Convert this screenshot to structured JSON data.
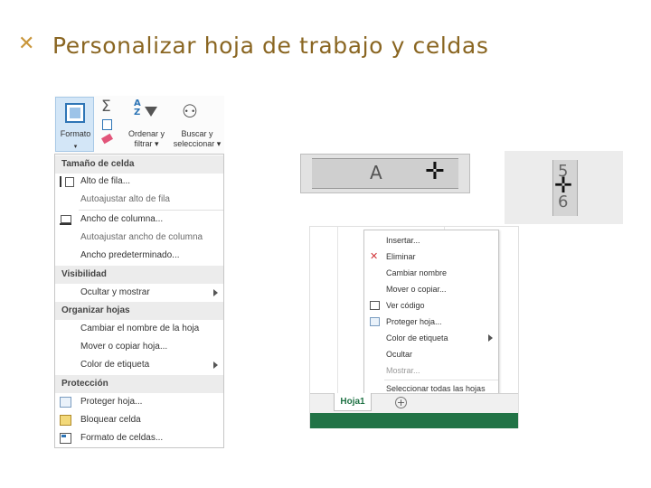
{
  "slide": {
    "bullet_glyph": "✕",
    "title": "Personalizar hoja de trabajo y celdas"
  },
  "ribbon": {
    "format_button": "Formato",
    "format_caret": "▾",
    "sort_filter": "Ordenar y filtrar ▾",
    "find_select": "Buscar y seleccionar ▾",
    "sort_icon_text": "A\nZ"
  },
  "format_menu": {
    "cell_size_header": "Tamaño de celda",
    "row_height": "Alto de fila...",
    "autofit_row_height": "Autoajustar alto de fila",
    "column_width": "Ancho de columna...",
    "autofit_column_width": "Autoajustar ancho de columna",
    "default_width": "Ancho predeterminado...",
    "visibility_header": "Visibilidad",
    "hide_unhide": "Ocultar y mostrar",
    "organize_header": "Organizar hojas",
    "rename_sheet": "Cambiar el nombre de la hoja",
    "move_copy_sheet": "Mover o copiar hoja...",
    "tab_color": "Color de etiqueta",
    "protection_header": "Protección",
    "protect_sheet": "Proteger hoja...",
    "lock_cell": "Bloquear celda",
    "format_cells": "Formato de celdas..."
  },
  "column_cursor": {
    "column_letter": "A",
    "cursor_glyph": "✛"
  },
  "row_cursor": {
    "row_top": "5",
    "row_bottom": "6",
    "cursor_glyph": "✛"
  },
  "sheet_context_menu": {
    "insert": "Insertar...",
    "delete": "Eliminar",
    "rename": "Cambiar nombre",
    "move_copy": "Mover o copiar...",
    "view_code": "Ver código",
    "protect_sheet": "Proteger hoja...",
    "tab_color": "Color de etiqueta",
    "hide": "Ocultar",
    "unhide": "Mostrar...",
    "select_all_sheets": "Seleccionar todas las hojas"
  },
  "sheet_tabs": {
    "active_tab": "Hoja1",
    "add_sheet_glyph": "+"
  },
  "colors": {
    "title": "#8a6622",
    "accent_blue": "#2e75b6",
    "excel_green": "#217346",
    "delete_red": "#d13438"
  }
}
